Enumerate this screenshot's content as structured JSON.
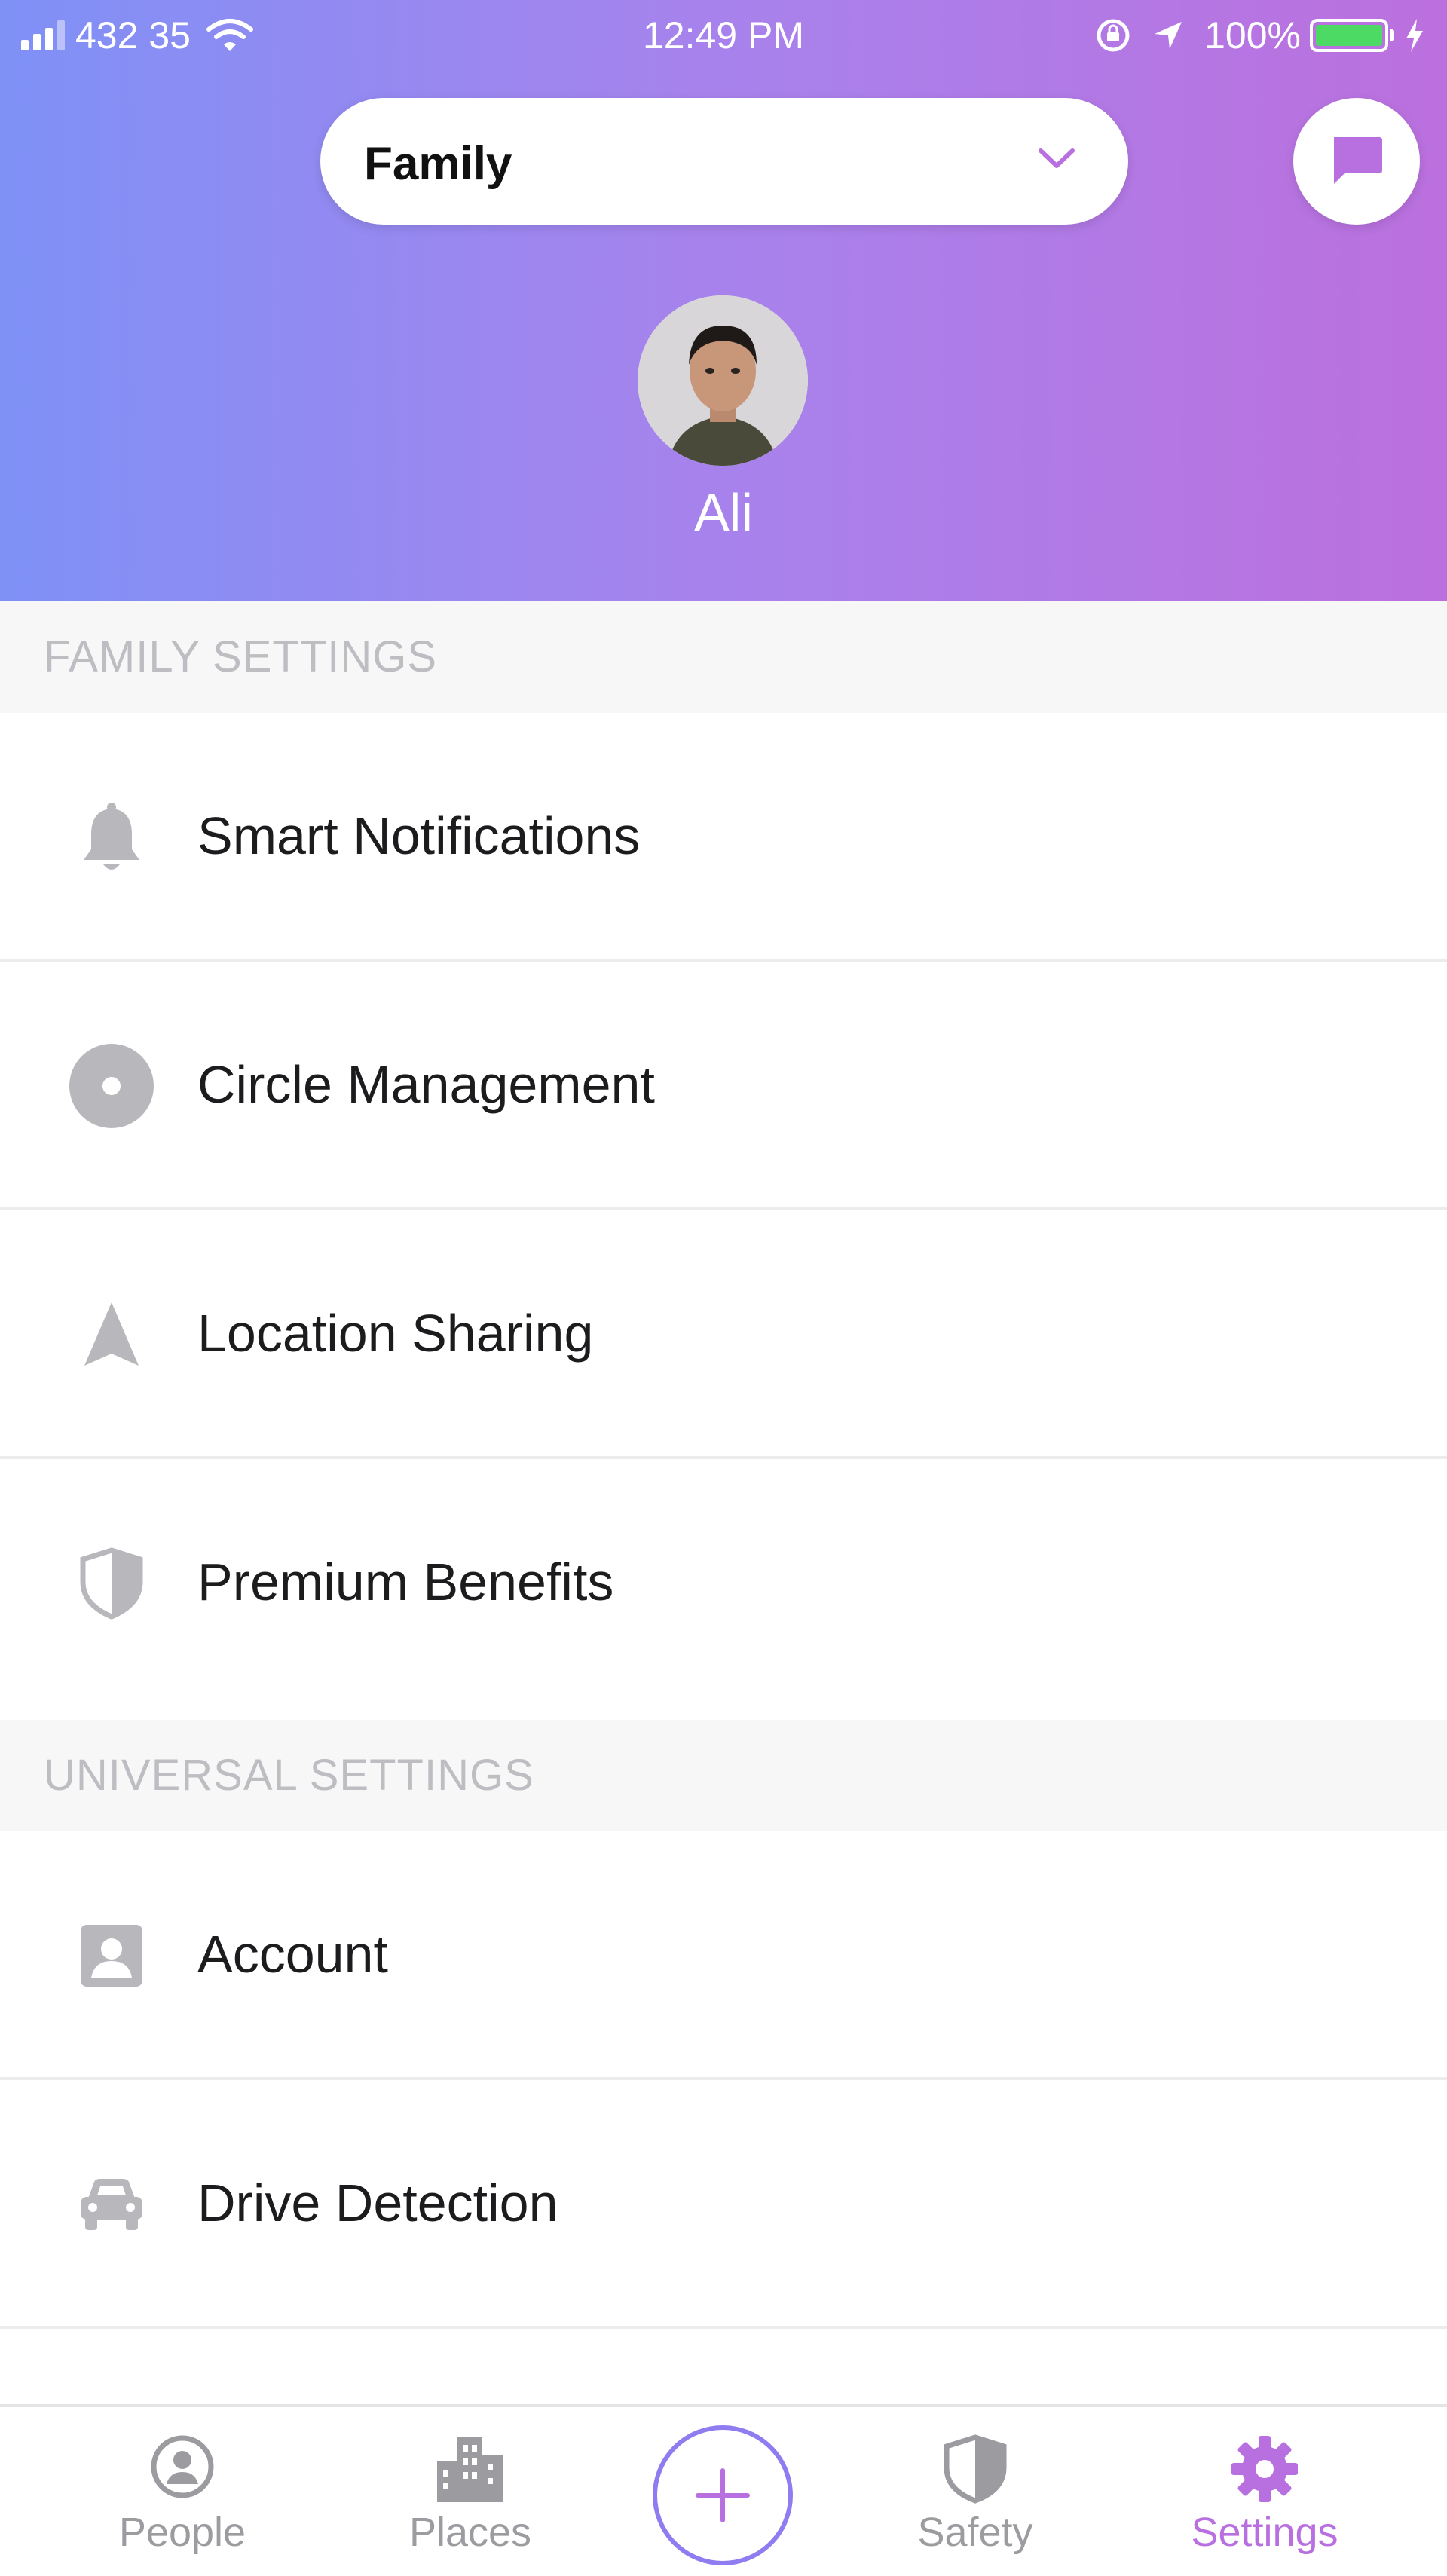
{
  "status_bar": {
    "carrier": "432 35",
    "time": "12:49 PM",
    "battery": "100%",
    "icons": [
      "signal-icon",
      "wifi-icon",
      "orientation-lock-icon",
      "location-arrow-icon",
      "battery-icon",
      "charging-bolt-icon"
    ]
  },
  "header": {
    "circle_name": "Family",
    "user_name": "Ali",
    "icons": [
      "chevron-down-icon",
      "chat-icon"
    ],
    "gradient": [
      "#7f91f6",
      "#bb70de"
    ]
  },
  "sections": [
    {
      "title": "FAMILY SETTINGS",
      "items": [
        {
          "label": "Smart Notifications",
          "icon": "bell-icon"
        },
        {
          "label": "Circle Management",
          "icon": "circle-icon"
        },
        {
          "label": "Location Sharing",
          "icon": "location-arrow-icon"
        },
        {
          "label": "Premium Benefits",
          "icon": "shield-icon"
        }
      ]
    },
    {
      "title": "UNIVERSAL SETTINGS",
      "items": [
        {
          "label": "Account",
          "icon": "account-icon"
        },
        {
          "label": "Drive Detection",
          "icon": "car-icon"
        }
      ]
    }
  ],
  "tab_bar": {
    "tabs": [
      {
        "label": "People",
        "icon": "person-icon"
      },
      {
        "label": "Places",
        "icon": "buildings-icon"
      },
      {
        "label": "Safety",
        "icon": "shield-icon"
      },
      {
        "label": "Settings",
        "icon": "gear-icon"
      }
    ],
    "add_icon": "plus-icon",
    "active_tab": "Settings",
    "active_color": "#b86fe0"
  }
}
